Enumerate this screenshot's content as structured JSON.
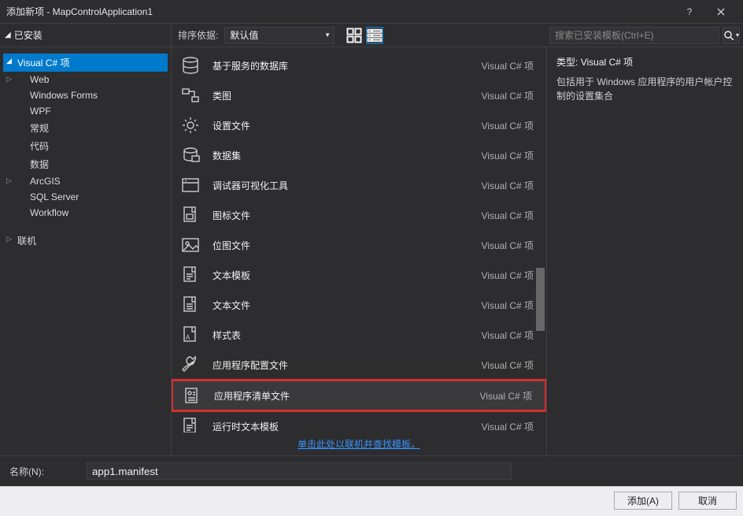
{
  "window": {
    "title": "添加新项 - MapControlApplication1",
    "help_glyph": "?",
    "close_glyph": "✕"
  },
  "toolbar": {
    "installed_tab": "已安装",
    "sort_label": "排序依据:",
    "sort_value": "默认值",
    "search_placeholder": "搜索已安装模板(Ctrl+E)"
  },
  "tree": {
    "items": [
      {
        "label": "Visual C# 项",
        "level": 1,
        "selected": true,
        "exp": "◢"
      },
      {
        "label": "Web",
        "level": 2,
        "exp": "▷"
      },
      {
        "label": "Windows Forms",
        "level": 2
      },
      {
        "label": "WPF",
        "level": 2
      },
      {
        "label": "常规",
        "level": 2
      },
      {
        "label": "代码",
        "level": 2
      },
      {
        "label": "数据",
        "level": 2
      },
      {
        "label": "ArcGIS",
        "level": 2,
        "exp": "▷"
      },
      {
        "label": "SQL Server",
        "level": 2
      },
      {
        "label": "Workflow",
        "level": 2
      },
      {
        "label": "联机",
        "level": 1,
        "exp": "▷"
      }
    ]
  },
  "templates": {
    "lang": "Visual C# 项",
    "rows": [
      {
        "name": "基于服务的数据库",
        "icon": "database"
      },
      {
        "name": "类图",
        "icon": "class-diagram"
      },
      {
        "name": "设置文件",
        "icon": "gear"
      },
      {
        "name": "数据集",
        "icon": "dataset"
      },
      {
        "name": "调试器可视化工具",
        "icon": "window"
      },
      {
        "name": "图标文件",
        "icon": "icon-file"
      },
      {
        "name": "位图文件",
        "icon": "image"
      },
      {
        "name": "文本模板",
        "icon": "text-template"
      },
      {
        "name": "文本文件",
        "icon": "text-file"
      },
      {
        "name": "样式表",
        "icon": "stylesheet"
      },
      {
        "name": "应用程序配置文件",
        "icon": "wrench"
      },
      {
        "name": "应用程序清单文件",
        "icon": "manifest",
        "highlight": true
      },
      {
        "name": "运行时文本模板",
        "icon": "text-template"
      }
    ],
    "online_link": "单击此处以联机并查找模板。"
  },
  "detail": {
    "type_label": "类型:",
    "type_value": "Visual C# 项",
    "description": "包括用于 Windows 应用程序的用户帐户控制的设置集合"
  },
  "name_field": {
    "label": "名称(N):",
    "value": "app1.manifest"
  },
  "buttons": {
    "add": "添加(A)",
    "cancel": "取消"
  },
  "icons": {
    "database": "db",
    "class-diagram": "cd",
    "gear": "gear",
    "dataset": "ds",
    "window": "win",
    "icon-file": "ico",
    "image": "img",
    "text-template": "tt",
    "text-file": "tf",
    "stylesheet": "css",
    "wrench": "wr",
    "manifest": "mf"
  }
}
